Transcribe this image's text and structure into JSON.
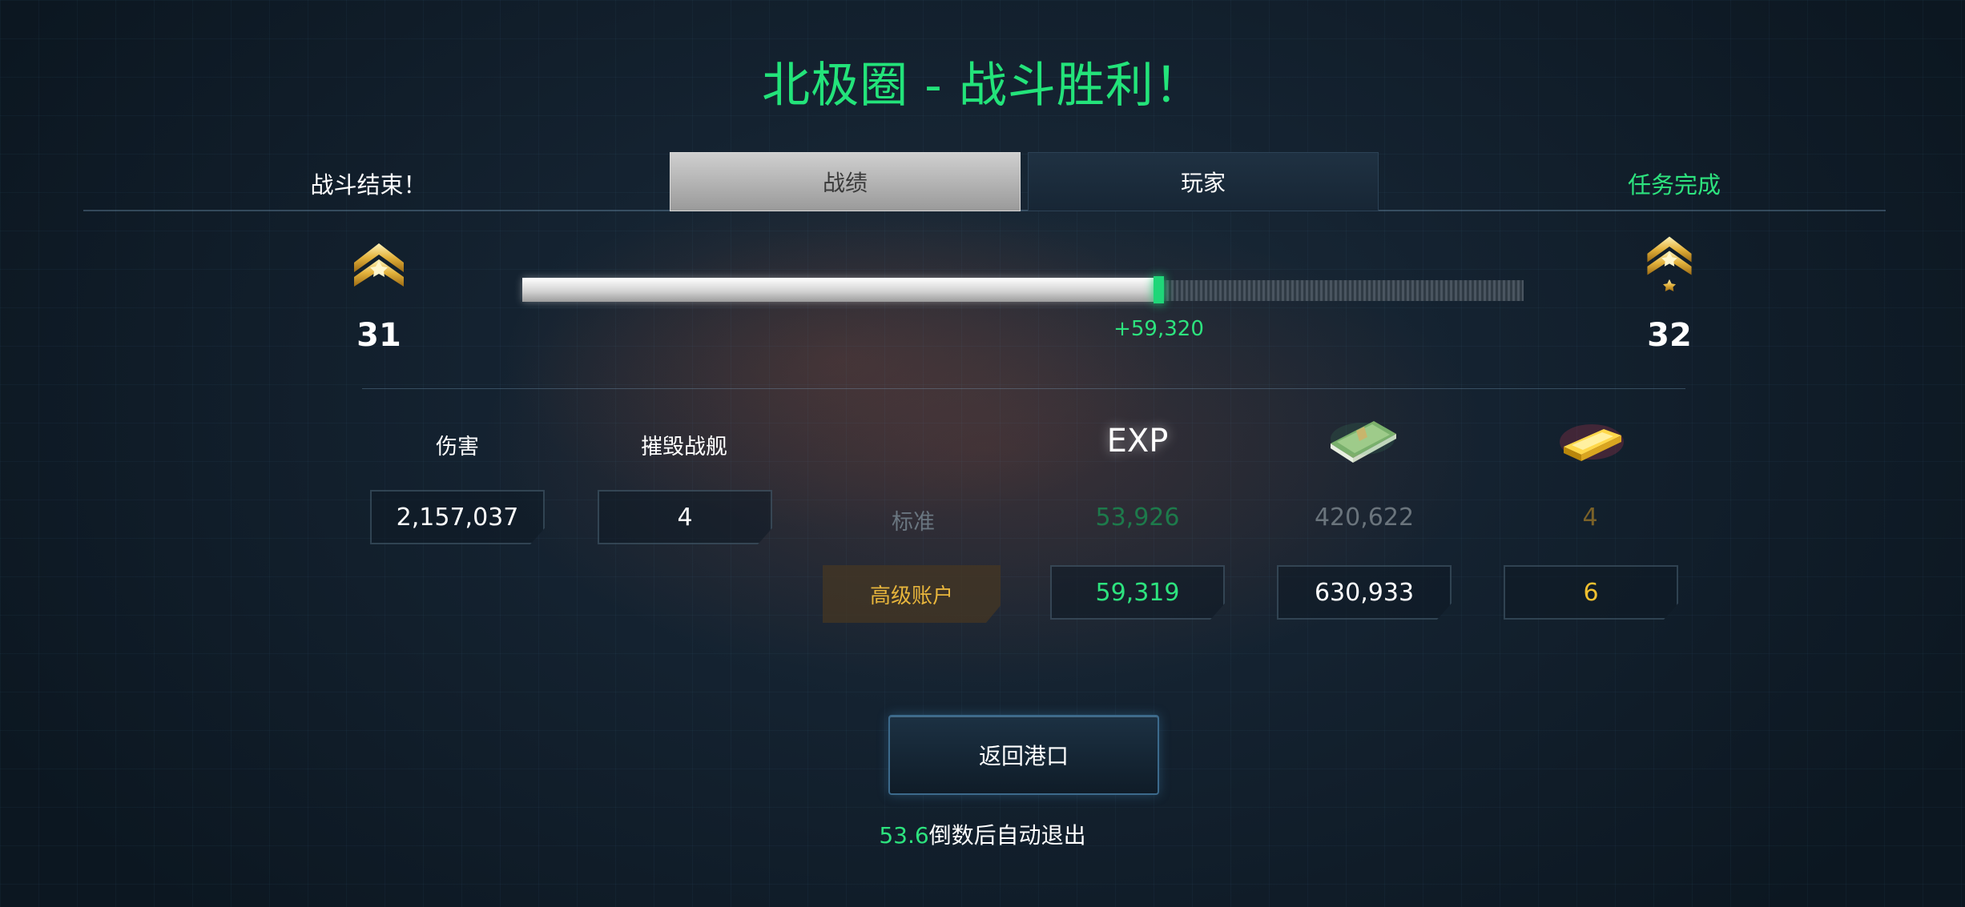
{
  "title": "北极圈 - 战斗胜利！",
  "header": {
    "left_label": "战斗结束！",
    "right_label": "任务完成",
    "tabs": [
      {
        "label": "战绩",
        "active": true
      },
      {
        "label": "玩家",
        "active": false
      }
    ]
  },
  "rank": {
    "current": "31",
    "next": "32",
    "progress_fraction": 0.63,
    "gain_fraction": 0.01,
    "gain_label": "+59,320"
  },
  "stats": {
    "damage_label": "伤害",
    "damage_value": "2,157,037",
    "destroyed_label": "摧毁战舰",
    "destroyed_value": "4"
  },
  "rewards": {
    "exp_label": "EXP",
    "standard_label": "标准",
    "standard": {
      "exp": "53,926",
      "credits": "420,622",
      "gold": "4"
    },
    "premium_label": "高级账户",
    "premium": {
      "exp": "59,319",
      "credits": "630,933",
      "gold": "6"
    }
  },
  "icons": {
    "credits": "money-stack-icon",
    "gold": "gold-bar-icon",
    "rank": "rank-chevron-icon"
  },
  "colors": {
    "accent_green": "#23e37a",
    "premium_gold": "#e7b53c",
    "gold_value": "#f0c030"
  },
  "footer": {
    "return_button": "返回港口",
    "countdown_value": "53.6",
    "countdown_text": "倒数后自动退出"
  }
}
